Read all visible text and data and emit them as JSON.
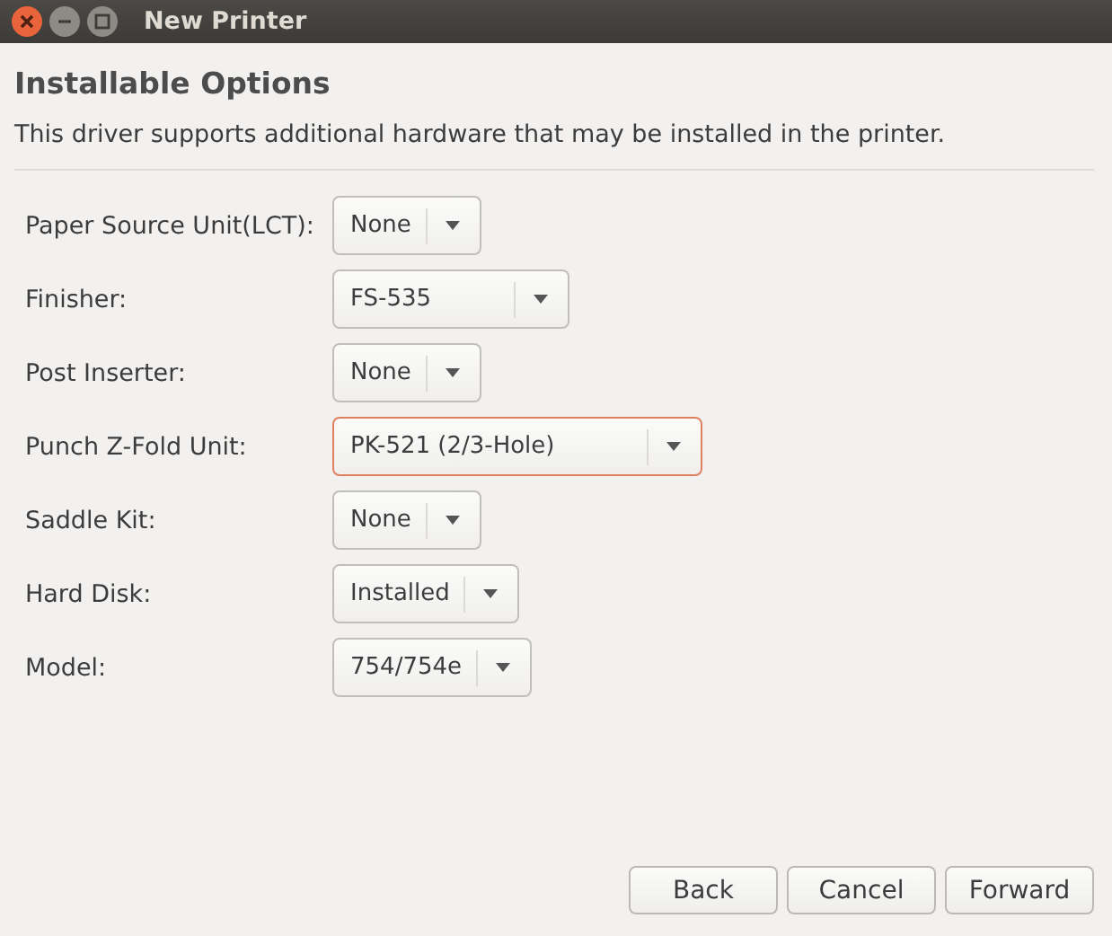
{
  "window": {
    "title": "New Printer"
  },
  "heading": "Installable Options",
  "description": "This driver supports additional hardware that may be installed in the printer.",
  "options": [
    {
      "label": "Paper Source Unit(LCT):",
      "value": "None",
      "focused": false
    },
    {
      "label": "Finisher:",
      "value": "FS-535",
      "focused": false
    },
    {
      "label": "Post Inserter:",
      "value": "None",
      "focused": false
    },
    {
      "label": "Punch Z-Fold Unit:",
      "value": "PK-521 (2/3-Hole)",
      "focused": true
    },
    {
      "label": "Saddle Kit:",
      "value": "None",
      "focused": false
    },
    {
      "label": "Hard Disk:",
      "value": "Installed",
      "focused": false
    },
    {
      "label": "Model:",
      "value": "754/754e",
      "focused": false
    }
  ],
  "buttons": [
    "Back",
    "Cancel",
    "Forward"
  ]
}
